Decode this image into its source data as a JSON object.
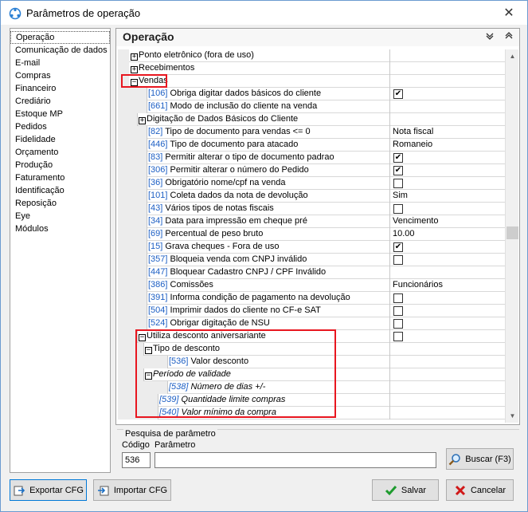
{
  "window": {
    "title": "Parâmetros de operação",
    "close_glyph": "✕"
  },
  "sidebar": {
    "items": [
      "Operação",
      "Comunicação de dados",
      "E-mail",
      "Compras",
      "Financeiro",
      "Crediário",
      "Estoque MP",
      "Pedidos",
      "Fidelidade",
      "Orçamento",
      "Produção",
      "Faturamento",
      "Identificação",
      "Reposição",
      "Eye",
      "Módulos"
    ],
    "active_index": 0
  },
  "panel": {
    "title": "Operação"
  },
  "grid": {
    "rows": [
      {
        "indent": 1,
        "toggle": "+",
        "code": "",
        "name": "Ponto eletrônico (fora de uso)",
        "value": "",
        "check": null
      },
      {
        "indent": 1,
        "toggle": "+",
        "code": "",
        "name": "Recebimentos",
        "value": "",
        "check": null
      },
      {
        "indent": 1,
        "toggle": "−",
        "code": "",
        "name": "Vendas",
        "value": "",
        "check": null
      },
      {
        "indent": 2,
        "toggle": "",
        "code": "[106]",
        "name": " Obriga digitar dados básicos do cliente",
        "value": "",
        "check": true
      },
      {
        "indent": 2,
        "toggle": "",
        "code": "[661]",
        "name": " Modo de inclusão do cliente na venda",
        "value": "",
        "check": null
      },
      {
        "indent": 2,
        "toggle": "+",
        "code": "",
        "name": "Digitação de Dados Básicos do Cliente",
        "value": "",
        "check": null
      },
      {
        "indent": 2,
        "toggle": "",
        "code": "[82]",
        "name": " Tipo de documento para vendas <= 0",
        "value": "Nota fiscal",
        "check": null
      },
      {
        "indent": 2,
        "toggle": "",
        "code": "[446]",
        "name": " Tipo de documento para atacado",
        "value": "Romaneio",
        "check": null
      },
      {
        "indent": 2,
        "toggle": "",
        "code": "[83]",
        "name": " Permitir alterar o tipo de documento padrao",
        "value": "",
        "check": true
      },
      {
        "indent": 2,
        "toggle": "",
        "code": "[306]",
        "name": " Permitir alterar o número do Pedido",
        "value": "",
        "check": true
      },
      {
        "indent": 2,
        "toggle": "",
        "code": "[36]",
        "name": " Obrigatório nome/cpf na venda",
        "value": "",
        "check": false
      },
      {
        "indent": 2,
        "toggle": "",
        "code": "[101]",
        "name": " Coleta dados da nota de devolução",
        "value": "Sim",
        "check": null
      },
      {
        "indent": 2,
        "toggle": "",
        "code": "[43]",
        "name": " Vários tipos de notas fiscais",
        "value": "",
        "check": false
      },
      {
        "indent": 2,
        "toggle": "",
        "code": "[34]",
        "name": " Data para impressão em cheque pré",
        "value": "Vencimento",
        "check": null
      },
      {
        "indent": 2,
        "toggle": "",
        "code": "[69]",
        "name": " Percentual de peso bruto",
        "value": "10.00",
        "check": null
      },
      {
        "indent": 2,
        "toggle": "",
        "code": "[15]",
        "name": " Grava cheques - Fora de uso",
        "value": "",
        "check": true
      },
      {
        "indent": 2,
        "toggle": "",
        "code": "[357]",
        "name": " Bloqueia venda com CNPJ inválido",
        "value": "",
        "check": false
      },
      {
        "indent": 2,
        "toggle": "",
        "code": "[447]",
        "name": " Bloquear Cadastro CNPJ / CPF Inválido",
        "value": "",
        "check": null
      },
      {
        "indent": 2,
        "toggle": "",
        "code": "[386]",
        "name": " Comissões",
        "value": "Funcionários",
        "check": null
      },
      {
        "indent": 2,
        "toggle": "",
        "code": "[391]",
        "name": " Informa condição de pagamento na devolução",
        "value": "",
        "check": false
      },
      {
        "indent": 2,
        "toggle": "",
        "code": "[504]",
        "name": " Imprimir dados do cliente no CF-e SAT",
        "value": "",
        "check": false
      },
      {
        "indent": 2,
        "toggle": "",
        "code": "[524]",
        "name": " Obrigar digitação de NSU",
        "value": "",
        "check": false
      },
      {
        "indent": 2,
        "toggle": "−",
        "code": "",
        "name": "Utiliza desconto aniversariante",
        "value": "",
        "check": false
      },
      {
        "indent": 3,
        "toggle": "−",
        "code": "",
        "name": "Tipo de desconto",
        "value": "",
        "check": null
      },
      {
        "indent": 4,
        "toggle": "",
        "code": "[536]",
        "name": " Valor desconto",
        "value": "",
        "check": null
      },
      {
        "indent": 3,
        "toggle": "−",
        "code": "",
        "name": "Período de validade",
        "value": "",
        "check": null,
        "italic": true
      },
      {
        "indent": 4,
        "toggle": "",
        "code": "[538]",
        "name": " Número de dias +/-",
        "value": "",
        "check": null,
        "italic": true
      },
      {
        "indent": 3,
        "toggle": "",
        "code": "[539]",
        "name": " Quantidade limite compras",
        "value": "",
        "check": null,
        "italic": true
      },
      {
        "indent": 3,
        "toggle": "",
        "code": "[540]",
        "name": " Valor mínimo da compra",
        "value": "",
        "check": null,
        "italic": true
      }
    ]
  },
  "search": {
    "legend": "Pesquisa de parâmetro",
    "code_label": "Código",
    "param_label": "Parâmetro",
    "code_value": "536",
    "param_value": "",
    "search_button": "Buscar (F3)"
  },
  "footer": {
    "export_button": "Exportar CFG",
    "import_button": "Importar CFG",
    "save_button": "Salvar",
    "cancel_button": "Cancelar"
  },
  "colors": {
    "code_blue": "#1d5fc4",
    "highlight_red": "#e8161f",
    "save_green": "#1e9b2e",
    "cancel_red": "#d01818"
  }
}
